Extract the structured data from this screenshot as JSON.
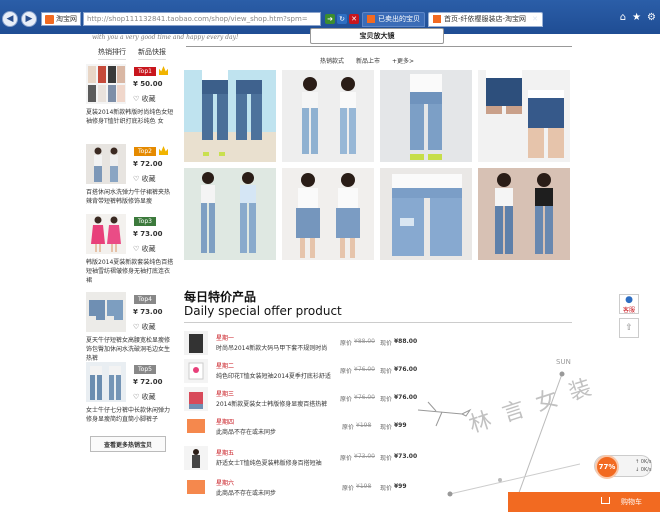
{
  "browser": {
    "favorites_label": "淘宝网",
    "address_host": "http://shop111132841.taobao.com",
    "address_path": "/shop/view_shop.htm?spm=",
    "tabs": [
      {
        "label": "已卖出的宝贝",
        "active": false
      },
      {
        "label": "首页-纤依樱服装店-淘宝网",
        "active": true
      }
    ]
  },
  "sidebar": {
    "script_text": "with you a very good time and happy every day!",
    "tabs": [
      "热销排行",
      "新品快报"
    ],
    "items": [
      {
        "badge": "Top1",
        "price": "¥ 50.00",
        "fav": "收藏",
        "desc": "夏装2014新款韩版时尚纯色女短袖修身T恤针织打底衫纯色 女"
      },
      {
        "badge": "Top2",
        "price": "¥ 72.00",
        "fav": "收藏",
        "desc": "百搭休闲水洗弹力牛仔裙裤夹热辣背带短裤韩版修饰显瘦"
      },
      {
        "badge": "Top3",
        "price": "¥ 73.00",
        "fav": "收藏",
        "desc": "韩版2014夏装新款套装纯色百搭短袖雪纺褶皱修身无袖打底连衣裙"
      },
      {
        "badge": "Top4",
        "price": "¥ 73.00",
        "fav": "收藏",
        "desc": "夏天牛仔短裤女高腰宽松显瘦修饰包臀加休闲水洗破洞毛边女生热裤"
      },
      {
        "badge": "Top5",
        "price": "¥ 72.00",
        "fav": "收藏",
        "desc": "女士牛仔七分裤中长款休闲弹力修身显瘦简约直筒小脚裤子"
      }
    ],
    "more_button": "查看更多热销宝贝"
  },
  "main": {
    "banner_title": "宝贝放大镜",
    "sub_tabs": [
      "热销款式",
      "新品上市",
      "+更多>"
    ],
    "daily_title": "每日特价产品",
    "daily_subtitle": "Daily special offer product",
    "offers": [
      {
        "name": "星期一",
        "desc": "时尚吊2014新款大码马甲下套不规则时尚",
        "orig_label": "原价",
        "orig": "¥88.00",
        "now_label": "现价",
        "now": "¥88.00"
      },
      {
        "name": "星期二",
        "desc": "纯色印花T恤女装短袖2014夏季打底衫舒适",
        "orig_label": "原价",
        "orig": "¥76.00",
        "now_label": "现价",
        "now": "¥76.00"
      },
      {
        "name": "星期三",
        "desc": "2014新款夏装女士韩版修身显瘦百搭热裤",
        "orig_label": "原价",
        "orig": "¥76.00",
        "now_label": "现价",
        "now": "¥76.00"
      },
      {
        "name": "星期四",
        "desc": "此商品不存在或未同步",
        "orig_label": "原价",
        "orig": "¥198",
        "now_label": "现价",
        "now": "¥99"
      },
      {
        "name": "星期五",
        "desc": "舒适女士T恤纯色夏装韩版修身百搭短袖",
        "orig_label": "原价",
        "orig": "¥73.00",
        "now_label": "现价",
        "now": "¥73.00"
      },
      {
        "name": "星期六",
        "desc": "此商品不存在或未同步",
        "orig_label": "原价",
        "orig": "¥198",
        "now_label": "现价",
        "now": "¥99"
      }
    ],
    "sun_label": "SUN",
    "watermark": "林 言 女 装"
  },
  "float": {
    "service_label": "客服",
    "speed_percent": "77%",
    "speed_up": "0K/s",
    "speed_down": "0K/s",
    "cart_label": "购物车"
  },
  "colors": {
    "accent": "#c8161d",
    "cart": "#f26a21",
    "chrome": "#1f4d94"
  }
}
